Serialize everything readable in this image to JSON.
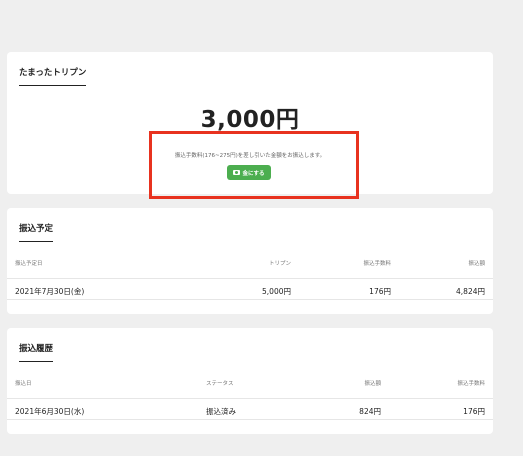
{
  "balance": {
    "title": "たまったトリプン",
    "amount": "3,000円",
    "note": "振込手数料(176~275円)を差し引いた金額をお振込します。",
    "cash_button": "金にする"
  },
  "scheduled": {
    "title": "振込予定",
    "columns": [
      "振込予定日",
      "トリプン",
      "振込手数料",
      "振込額"
    ],
    "rows": [
      [
        "2021年7月30日(金)",
        "5,000円",
        "176円",
        "4,824円"
      ]
    ]
  },
  "history": {
    "title": "振込履歴",
    "columns": [
      "振込日",
      "ステータス",
      "振込額",
      "振込手数料"
    ],
    "rows": [
      [
        "2021年6月30日(水)",
        "振込済み",
        "824円",
        "176円"
      ]
    ]
  },
  "colors": {
    "button": "#4cae4f",
    "highlight": "#e8321f"
  },
  "icons": [
    "money-icon"
  ]
}
